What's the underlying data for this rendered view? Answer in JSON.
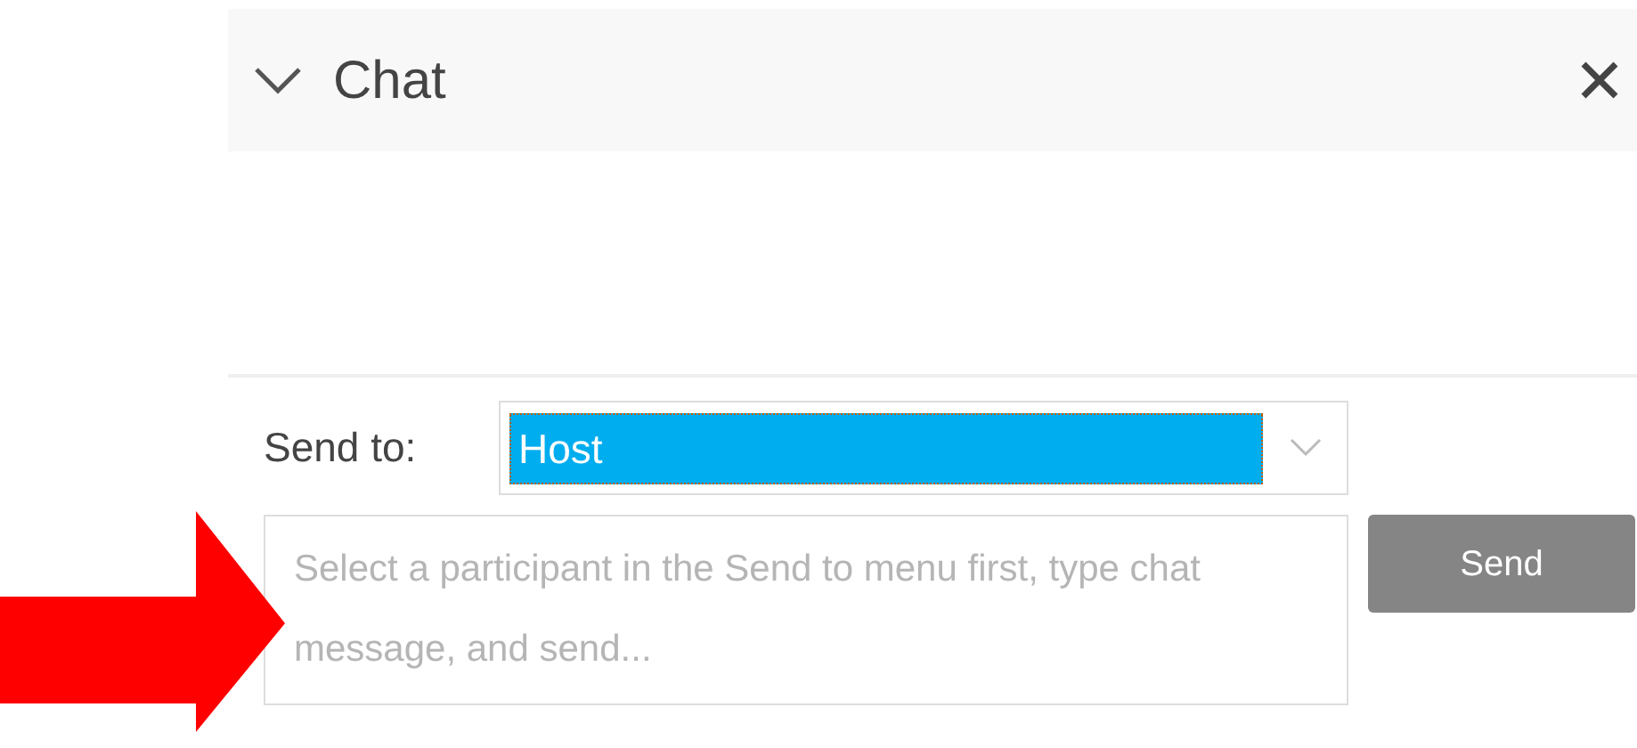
{
  "panel": {
    "title": "Chat",
    "expanded": true
  },
  "send_to": {
    "label": "Send to:",
    "value": "Host"
  },
  "message": {
    "placeholder": "Select a participant in the Send to menu first, type chat message, and send..."
  },
  "send_button": {
    "label": "Send"
  }
}
